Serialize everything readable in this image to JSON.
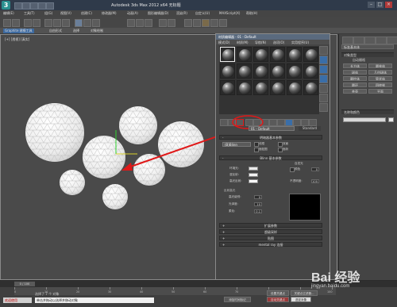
{
  "app": {
    "logo_text": "3",
    "title": "Autodesk 3ds Max 2012 x64   无标题"
  },
  "menubar": {
    "items": [
      "编辑(E)",
      "工具(T)",
      "组(G)",
      "视图(V)",
      "创建(C)",
      "修改器(M)",
      "动画(A)",
      "图形编辑器(D)",
      "渲染(R)",
      "自定义(U)",
      "MAXScript(X)",
      "帮助(H)"
    ]
  },
  "ribbon": {
    "tabs": [
      "Graphite 建模工具",
      "自由形式",
      "选择",
      "对象绘制"
    ]
  },
  "viewport": {
    "label": "[+] [透视] [真实]"
  },
  "material_editor": {
    "title": "材质编辑器 - 01 - Default",
    "menus": [
      "模式(D)",
      "材质(M)",
      "导航(N)",
      "选项(O)",
      "实用程序(U)"
    ],
    "material_name": "01 - Default",
    "material_type": "Standard",
    "rollouts": {
      "shader_basic": "明暗器基本参数",
      "blinn_basic": "Blinn 基本参数",
      "extended": "扩展参数",
      "supersampling": "超级采样",
      "maps": "贴图",
      "mental_ray": "mental ray 连接"
    },
    "shader": {
      "type": "(B)Blinn",
      "wire": "线框",
      "two_sided": "双面",
      "face_map": "面贴图",
      "faceted": "面状"
    },
    "blinn": {
      "ambient": "环境光:",
      "diffuse": "漫反射:",
      "specular": "高光反射:",
      "self_illum": "自发光",
      "color": "颜色",
      "opacity_label": "不透明度:",
      "opacity_value": "100",
      "self_illum_value": "0"
    },
    "specular_highlights": {
      "title": "反射高光",
      "level_label": "高光级别:",
      "level_value": "0",
      "gloss_label": "光泽度:",
      "gloss_value": "10",
      "soften_label": "柔化:",
      "soften_value": "0.1"
    }
  },
  "command_panel": {
    "category": "标准基本体",
    "object_type_header": "对象类型",
    "autogrid": "自动栅格",
    "buttons": [
      "长方体",
      "圆锥体",
      "球体",
      "几何球体",
      "圆柱体",
      "管状体",
      "圆环",
      "四棱锥",
      "茶壶",
      "平面"
    ],
    "name_color_header": "名称和颜色"
  },
  "timeline": {
    "frame_display": "0 / 100",
    "ticks": [
      "0",
      "10",
      "20",
      "30",
      "40",
      "50",
      "60",
      "70",
      "80",
      "90",
      "100"
    ]
  },
  "status": {
    "selection": "选择了 7 个 对象",
    "prompt": "单击并拖动以选择并移动对象",
    "welcome": "欢迎使用",
    "add_time_tag": "添加时间标记",
    "auto_key": "自动关键点",
    "set_key": "设置关键点",
    "key_filters": "关键点过滤器...",
    "selected": "选定对象"
  },
  "watermark": {
    "text": "Bai 经验",
    "sub": "jingyan.baidu.com"
  },
  "colors": {
    "annotation_red": "#e01818",
    "gizmo_green": "#2fd12f",
    "title_blue": "#5a6a7e"
  }
}
